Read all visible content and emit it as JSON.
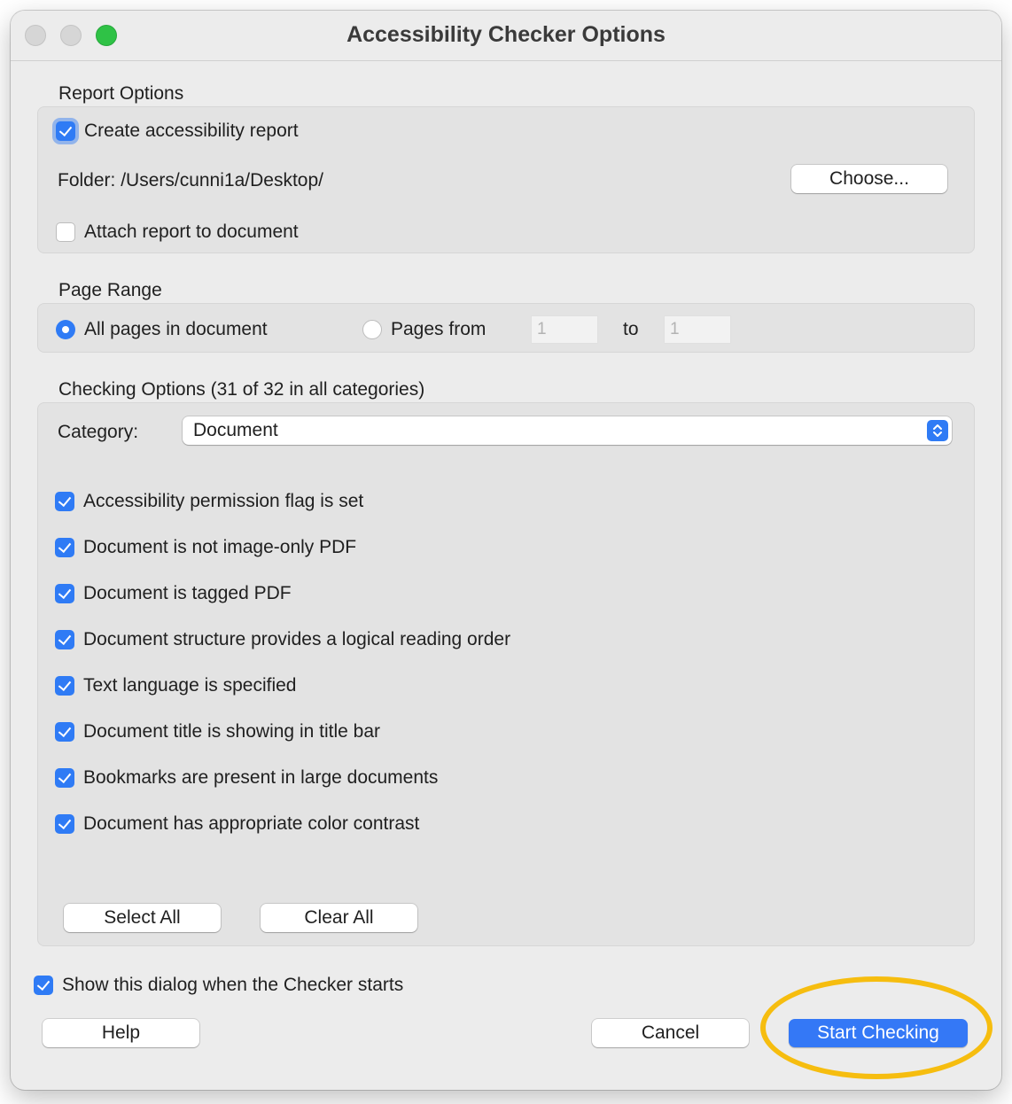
{
  "window": {
    "title": "Accessibility Checker Options"
  },
  "report_options": {
    "label": "Report Options",
    "create_report": {
      "label": "Create accessibility report",
      "checked": true
    },
    "folder_text": "Folder: /Users/cunni1a/Desktop/",
    "choose_button": "Choose...",
    "attach_report": {
      "label": "Attach report to document",
      "checked": false
    }
  },
  "page_range": {
    "label": "Page Range",
    "all_pages": "All pages in document",
    "pages_from": "Pages from",
    "from_value": "1",
    "to_label": "to",
    "to_value": "1",
    "selected": "all_pages"
  },
  "checking_options": {
    "label": "Checking Options (31 of 32 in all categories)",
    "category_label": "Category:",
    "category_value": "Document",
    "items": [
      {
        "label": "Accessibility permission flag is set",
        "checked": true
      },
      {
        "label": "Document is not image-only PDF",
        "checked": true
      },
      {
        "label": "Document is tagged PDF",
        "checked": true
      },
      {
        "label": "Document structure provides a logical reading order",
        "checked": true
      },
      {
        "label": "Text language is specified",
        "checked": true
      },
      {
        "label": "Document title is showing in title bar",
        "checked": true
      },
      {
        "label": "Bookmarks are present in large documents",
        "checked": true
      },
      {
        "label": "Document has appropriate color contrast",
        "checked": true
      }
    ],
    "select_all": "Select All",
    "clear_all": "Clear All"
  },
  "footer": {
    "show_dialog": {
      "label": "Show this dialog when the Checker starts",
      "checked": true
    },
    "help": "Help",
    "cancel": "Cancel",
    "start": "Start Checking"
  },
  "colors": {
    "accent": "#3478f6",
    "highlight": "#f6bd0f"
  }
}
